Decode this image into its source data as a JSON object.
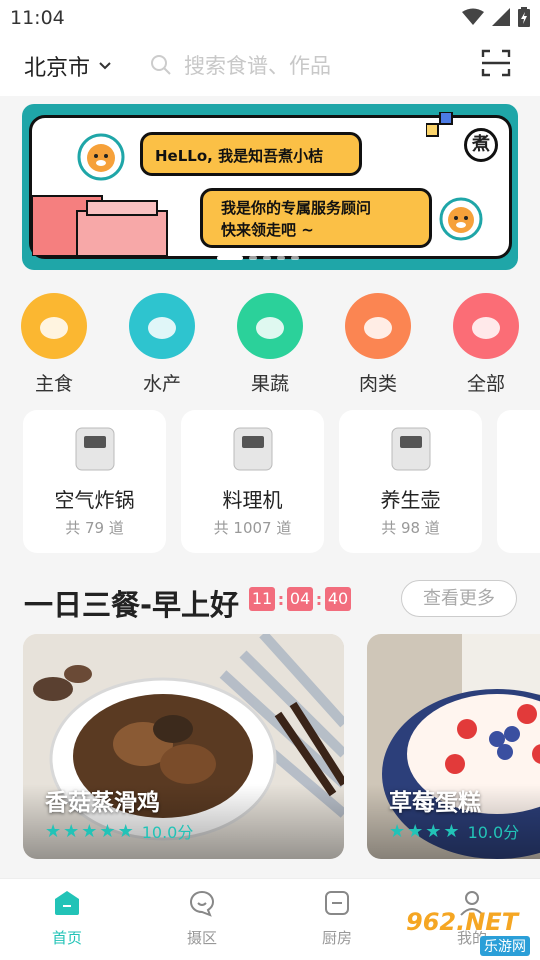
{
  "status": {
    "time": "11:04"
  },
  "header": {
    "city": "北京市",
    "search_placeholder": "搜索食谱、作品"
  },
  "banner": {
    "greeting": "HeLLo, 我是知吾煮小桔",
    "intro_line1": "我是你的专属服务顾问",
    "intro_line2": "快来领走吧 ~",
    "logo_char": "煮",
    "page_count": 5,
    "active_page": 1
  },
  "categories": [
    {
      "label": "主食",
      "color": "#fbb731"
    },
    {
      "label": "水产",
      "color": "#2ec4cf"
    },
    {
      "label": "果蔬",
      "color": "#2bd19a"
    },
    {
      "label": "肉类",
      "color": "#fb8552"
    },
    {
      "label": "全部",
      "color": "#fb6d76"
    }
  ],
  "appliances": [
    {
      "name": "空气炸锅",
      "count": "共 79 道"
    },
    {
      "name": "料理机",
      "count": "共 1007 道"
    },
    {
      "name": "养生壶",
      "count": "共 98 道"
    }
  ],
  "meals": {
    "title": "一日三餐-早上好",
    "timer": {
      "h": "11",
      "m": "04",
      "s": "40"
    },
    "more_label": "查看更多",
    "recipes": [
      {
        "name": "香菇蒸滑鸡",
        "score": "10.0分",
        "stars": 5
      },
      {
        "name": "草莓蛋糕",
        "score": "10.0分",
        "stars": 5
      }
    ]
  },
  "nav": {
    "items": [
      {
        "label": "首页",
        "active": true
      },
      {
        "label": "摄区",
        "active": false
      },
      {
        "label": "厨房",
        "active": false
      },
      {
        "label": "我的",
        "active": false
      }
    ]
  },
  "watermark": {
    "brand": "962.NET",
    "sub": "乐游网"
  },
  "colors": {
    "accent": "#22c3b7",
    "banner_bg": "#1fa6a8",
    "bubble": "#fbc046",
    "timer": "#f26d7d"
  }
}
